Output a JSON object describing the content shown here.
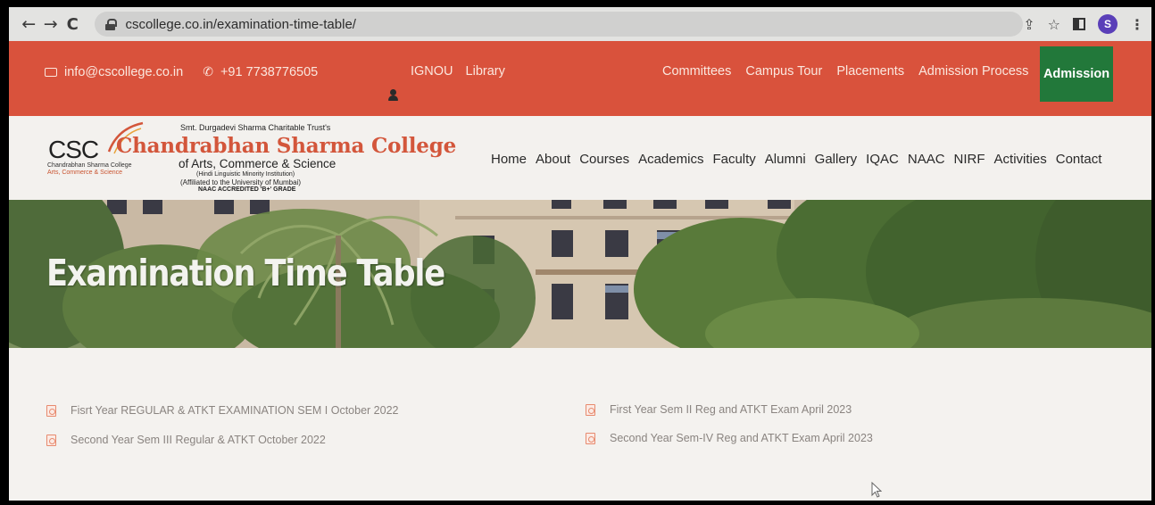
{
  "browser": {
    "url": "cscollege.co.in/examination-time-table/",
    "profile_initial": "S"
  },
  "topbar": {
    "email": "info@cscollege.co.in",
    "phone": "+91 7738776505",
    "quick_links": [
      "IGNOU",
      "Library"
    ],
    "right_links": [
      "Committees",
      "Campus Tour",
      "Placements",
      "Admission Process"
    ],
    "admission_label": "Admission"
  },
  "logo": {
    "abbr": "CSC",
    "trust": "Smt. Durgadevi Sharma Charitable Trust's",
    "name": "Chandrabhan Sharma College",
    "streams": "of Arts, Commerce & Science",
    "minority": "(Hindi Linguistic Minority Institution)",
    "affiliation": "(Affiliated to the University of Mumbai)",
    "naac": "NAAC ACCREDITED 'B+' GRADE",
    "small_name": "Chandrabhan Sharma College",
    "small_streams": "Arts, Commerce & Science"
  },
  "nav": [
    "Home",
    "About",
    "Courses",
    "Academics",
    "Faculty",
    "Alumni",
    "Gallery",
    "IQAC",
    "NAAC",
    "NIRF",
    "Activities",
    "Contact"
  ],
  "hero": {
    "title": "Examination Time Table"
  },
  "documents": {
    "left": [
      "Fisrt Year REGULAR & ATKT EXAMINATION SEM I October 2022",
      "Second Year Sem III Regular & ATKT October 2022"
    ],
    "right": [
      "First Year Sem II Reg and ATKT Exam April 2023",
      "Second Year Sem-IV Reg and ATKT Exam April 2023"
    ]
  },
  "colors": {
    "topbar": "#d9523c",
    "admission": "#22783a",
    "brand_red": "#d3563b",
    "pdf_icon": "#e78a6e"
  }
}
